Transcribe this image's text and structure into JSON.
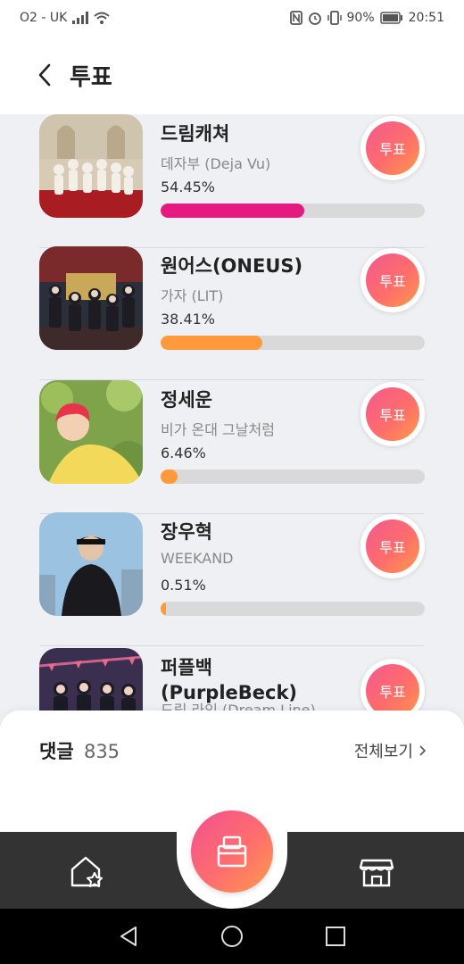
{
  "status_bar": {
    "carrier": "O2 - UK",
    "battery": "90%",
    "time": "20:51",
    "icons": [
      "signal-icon",
      "wifi-icon",
      "nfc-icon",
      "alarm-icon",
      "vibrate-icon",
      "battery-icon"
    ]
  },
  "header": {
    "title": "투표",
    "back_icon": "chevron-left-icon"
  },
  "candidates": [
    {
      "name": "드림캐쳐",
      "song": "데자부 (Deja Vu)",
      "percent_label": "54.45%",
      "percent": 54.45,
      "bar_color": "#e5197f",
      "vote_label": "투표"
    },
    {
      "name": "원어스(ONEUS)",
      "song": "가자 (LIT)",
      "percent_label": "38.41%",
      "percent": 38.41,
      "bar_color": "#ff9a3c",
      "vote_label": "투표"
    },
    {
      "name": "정세운",
      "song": "비가 온대 그날처럼",
      "percent_label": "6.46%",
      "percent": 6.46,
      "bar_color": "#ff9a3c",
      "vote_label": "투표"
    },
    {
      "name": "장우혁",
      "song": "WEEKAND",
      "percent_label": "0.51%",
      "percent": 0.51,
      "bar_color": "#ff9a3c",
      "vote_label": "투표"
    },
    {
      "name": "퍼플백(PurpleBeck)",
      "song": "드림 라인 (Dream Line)",
      "percent_label": "",
      "percent": 0,
      "bar_color": "#ff9a3c",
      "vote_label": "투표"
    }
  ],
  "comments": {
    "label": "댓글",
    "count": "835",
    "view_all": "전체보기"
  },
  "bottom_nav": {
    "items": [
      "home-star-icon",
      "vote-box-icon",
      "store-icon"
    ]
  },
  "colors": {
    "accent_pink": "#e5197f",
    "accent_orange": "#ff9a3c",
    "background": "#eef0f4",
    "nav_dark": "#333333"
  }
}
